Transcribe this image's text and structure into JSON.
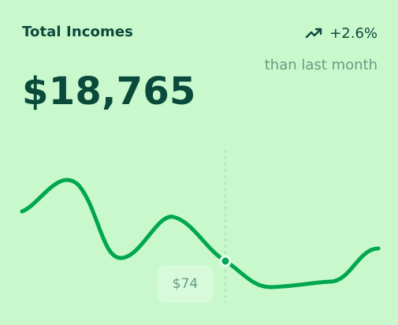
{
  "card": {
    "title": "Total Incomes",
    "trend": {
      "icon": "trend-up-icon",
      "value": "+2.6%"
    },
    "comparison_label": "than last month",
    "amount": "$18,765",
    "tooltip_value": "$74",
    "colors": {
      "background": "#C8F8CC",
      "line": "#00A650",
      "text_dark": "#0A4A3B",
      "text_muted": "#6B9A84"
    }
  }
}
